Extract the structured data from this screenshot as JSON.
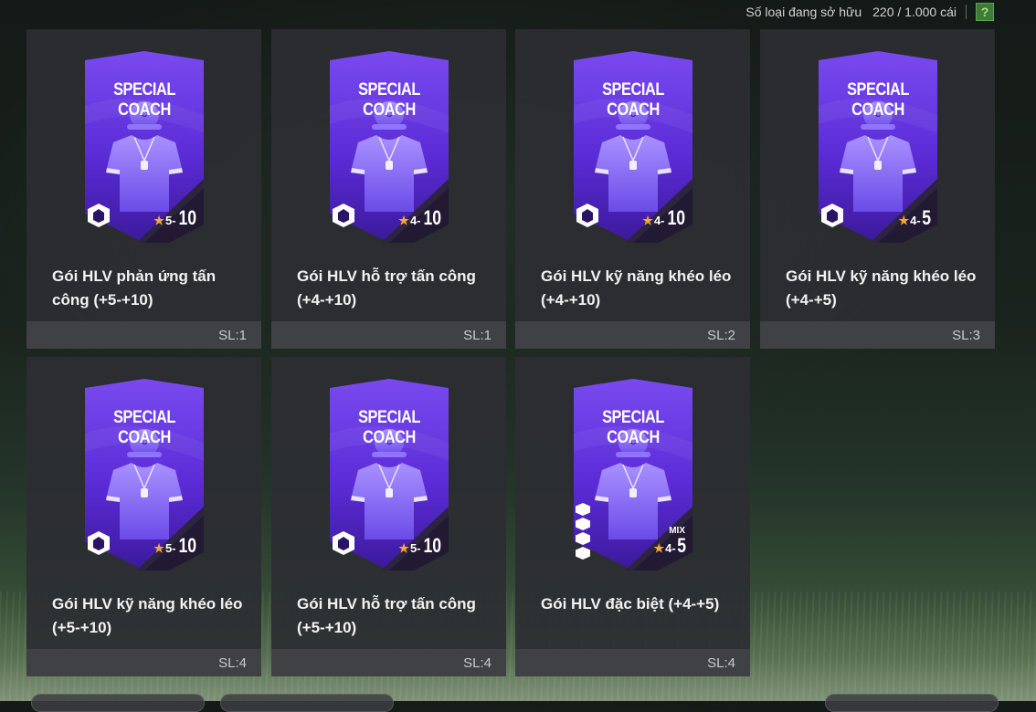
{
  "header": {
    "owned_label": "Số loại đang sở hữu",
    "owned_count": "220 / 1.000 cái",
    "help_label": "?"
  },
  "pack_title": "SPECIAL COACH",
  "colors": {
    "pack_purple": "#5b2bd6",
    "pack_dark": "#2a1466",
    "star": "#f2a93b"
  },
  "cards": [
    {
      "name": "Gói HLV phản ứng tấn công (+5-+10)",
      "qty": "SL:1",
      "rating_lo": "5",
      "rating_hi": "10",
      "badge": "counter-attack-icon",
      "mix": ""
    },
    {
      "name": "Gói HLV hỗ trợ tấn công (+4-+10)",
      "qty": "SL:1",
      "rating_lo": "4",
      "rating_hi": "10",
      "badge": "attack-support-icon",
      "mix": ""
    },
    {
      "name": "Gói HLV kỹ năng khéo léo (+4-+10)",
      "qty": "SL:2",
      "rating_lo": "4",
      "rating_hi": "10",
      "badge": "skill-icon",
      "mix": ""
    },
    {
      "name": "Gói HLV kỹ năng khéo léo (+4-+5)",
      "qty": "SL:3",
      "rating_lo": "4",
      "rating_hi": "5",
      "badge": "skill-icon",
      "mix": ""
    },
    {
      "name": "Gói HLV kỹ năng khéo léo (+5-+10)",
      "qty": "SL:4",
      "rating_lo": "5",
      "rating_hi": "10",
      "badge": "skill-icon",
      "mix": ""
    },
    {
      "name": "Gói HLV hỗ trợ tấn công (+5-+10)",
      "qty": "SL:4",
      "rating_lo": "5",
      "rating_hi": "10",
      "badge": "attack-support-icon",
      "mix": ""
    },
    {
      "name": "Gói HLV đặc biệt (+4-+5)",
      "qty": "SL:4",
      "rating_lo": "4",
      "rating_hi": "5",
      "badge": "mixed-badges-icon",
      "mix": "MIX"
    }
  ]
}
